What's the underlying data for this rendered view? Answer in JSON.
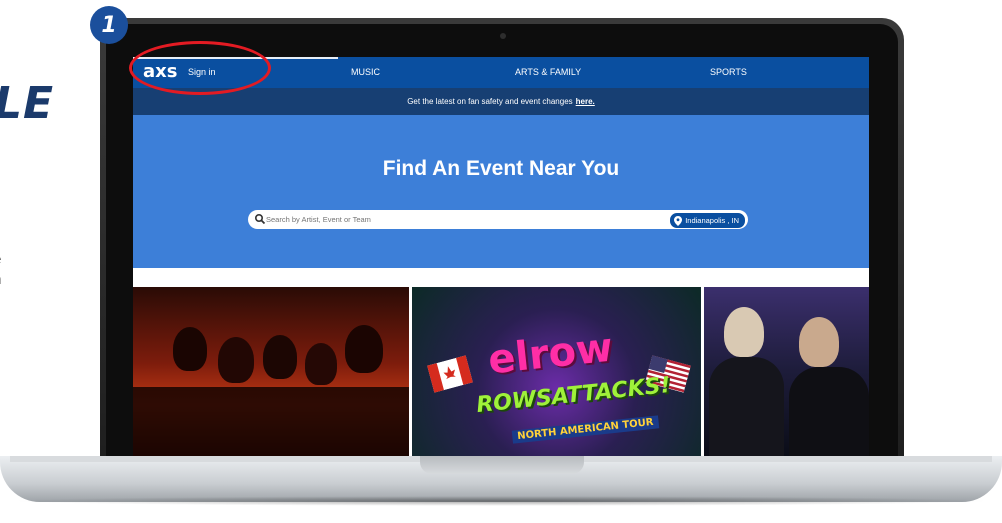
{
  "side": {
    "title_fragment": "LE",
    "line1": "e",
    "line2": "n"
  },
  "step_badge": "1",
  "navbar": {
    "logo": "axs",
    "signin": "Sign in",
    "items": [
      "MUSIC",
      "ARTS & FAMILY",
      "SPORTS"
    ]
  },
  "notice": {
    "text": "Get the latest on fan safety and event changes",
    "link": "here."
  },
  "hero": {
    "title": "Find An Event Near You",
    "search_placeholder": "Search by Artist, Event or Team",
    "location": "Indianapolis , IN"
  },
  "tiles": {
    "elrow_text": "elrow",
    "rows_text": "ROWSATTACKS!",
    "tour_text": "NORTH AMERICAN TOUR"
  },
  "colors": {
    "navbar": "#0a4fa0",
    "notice": "#173f73",
    "hero": "#3d7fd8",
    "annotation": "#e31b23",
    "badge": "#1b4f9c"
  },
  "icons": [
    "search-icon",
    "location-pin-icon"
  ]
}
